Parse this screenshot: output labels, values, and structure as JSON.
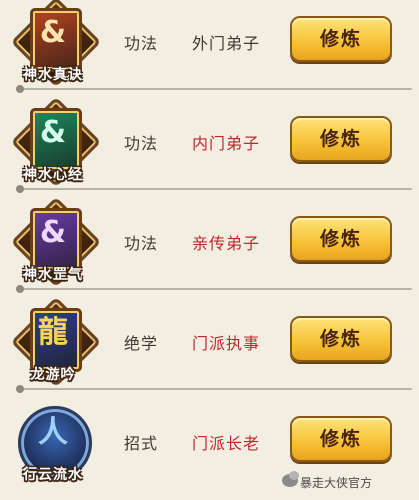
{
  "rows": [
    {
      "icon_name": "神水真诀",
      "glyph": "&",
      "type": "功法",
      "requirement": "外门弟子",
      "req_color": "#3f3a33",
      "button": "修炼",
      "icon_shape": "diamond",
      "bg": "#b4431e",
      "frame": "#f0c260",
      "glyph_color": "#fbe6b0"
    },
    {
      "icon_name": "神水心经",
      "glyph": "&",
      "type": "功法",
      "requirement": "内门弟子",
      "req_color": "#c0272d",
      "button": "修炼",
      "icon_shape": "diamond",
      "bg": "#1b8a5c",
      "frame": "#f0c260",
      "glyph_color": "#d6ffe8"
    },
    {
      "icon_name": "神水罡气",
      "glyph": "&",
      "type": "功法",
      "requirement": "亲传弟子",
      "req_color": "#c0272d",
      "button": "修炼",
      "icon_shape": "diamond",
      "bg": "#6b3aa8",
      "frame": "#f0c260",
      "glyph_color": "#efd8ff"
    },
    {
      "icon_name": "龙游吟",
      "glyph": "龍",
      "type": "绝学",
      "requirement": "门派执事",
      "req_color": "#c0272d",
      "button": "修炼",
      "icon_shape": "diamond",
      "bg": "#2f3e8c",
      "frame": "#f0c260",
      "glyph_color": "#f7d35a"
    },
    {
      "icon_name": "行云流水",
      "glyph": "人",
      "type": "招式",
      "requirement": "门派长老",
      "req_color": "#c0272d",
      "button": "修炼",
      "icon_shape": "circle",
      "bg": "#1c2b55",
      "frame": "#7fa9d9",
      "glyph_color": "#9ed0ff"
    }
  ],
  "watermark": "暴走大侠官方"
}
